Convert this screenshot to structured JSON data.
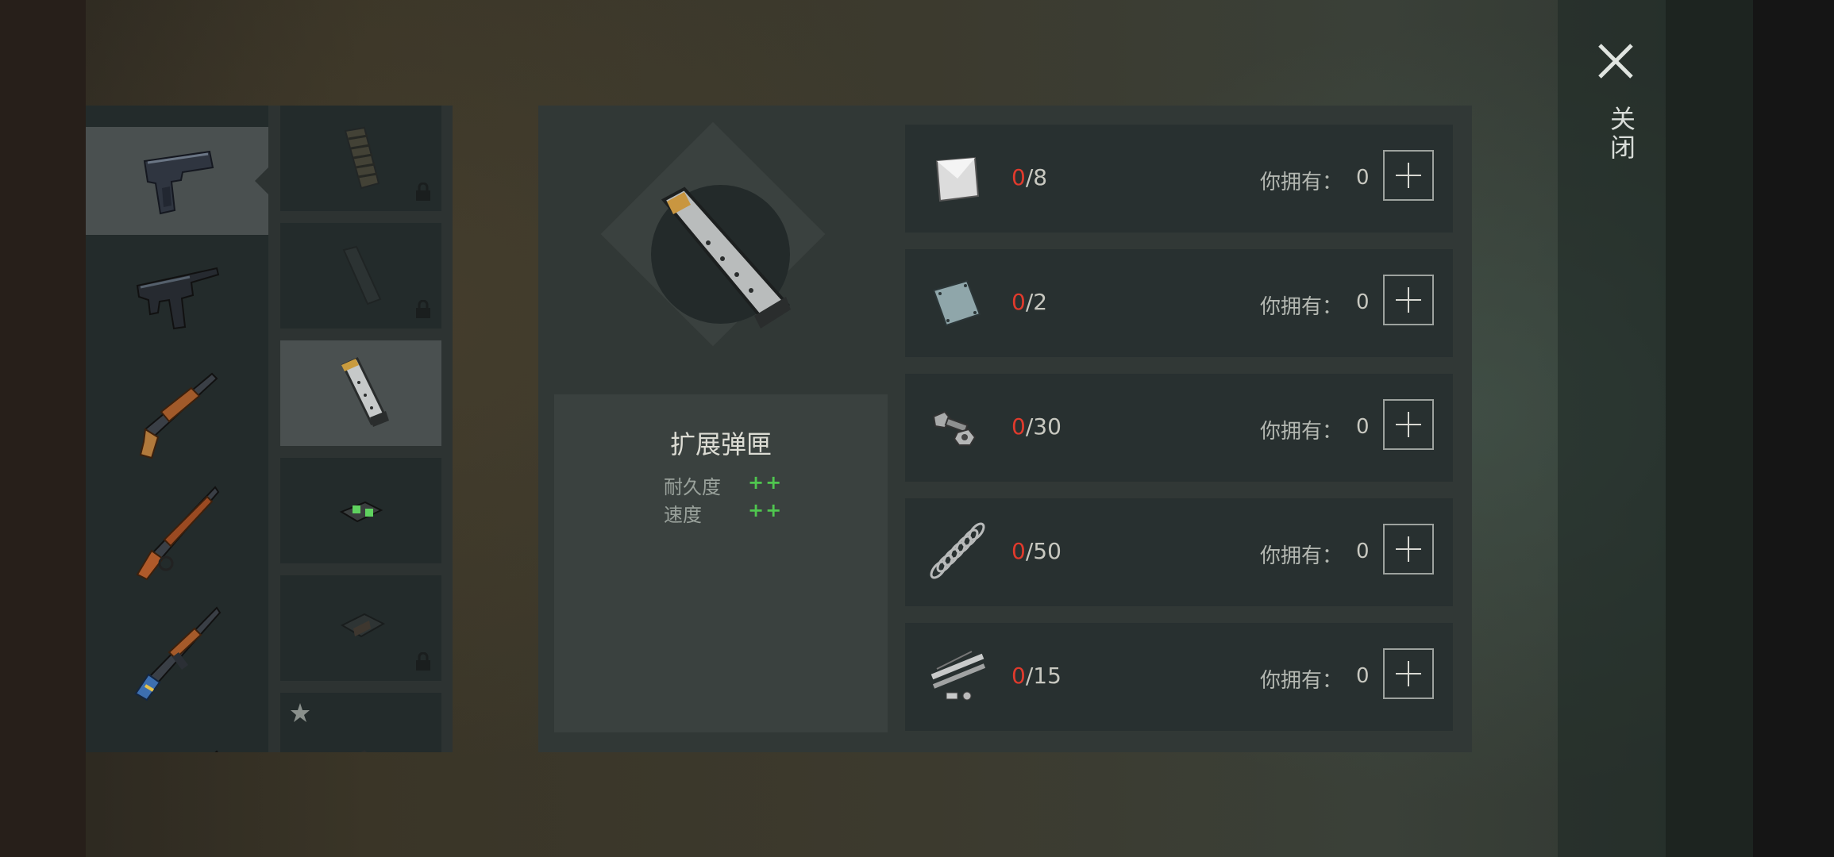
{
  "close": {
    "label": "关闭"
  },
  "item": {
    "name": "扩展弹匣",
    "stats": [
      {
        "label": "耐久度",
        "value": "++"
      },
      {
        "label": "速度",
        "value": "++"
      }
    ]
  },
  "weapons": [
    {
      "icon": "pistol-icon",
      "selected": true
    },
    {
      "icon": "smg-icon"
    },
    {
      "icon": "shotgun-icon"
    },
    {
      "icon": "lever-rifle-icon"
    },
    {
      "icon": "assault-rifle-icon"
    },
    {
      "icon": "rifle-icon"
    }
  ],
  "attachments": [
    {
      "icon": "drum-magazine-icon",
      "locked": true
    },
    {
      "icon": "magazine-icon",
      "locked": true
    },
    {
      "icon": "extended-magazine-icon",
      "selected": true
    },
    {
      "icon": "night-sights-icon"
    },
    {
      "icon": "red-dot-sight-icon",
      "locked": true
    },
    {
      "icon": "rear-sight-icon",
      "starred": true
    }
  ],
  "requirements": [
    {
      "icon": "metal-sheet-icon",
      "have": "0",
      "need": "/8",
      "owned_label": "你拥有：",
      "owned": "0"
    },
    {
      "icon": "steel-plate-icon",
      "have": "0",
      "need": "/2",
      "owned_label": "你拥有：",
      "owned": "0"
    },
    {
      "icon": "bolt-nut-icon",
      "have": "0",
      "need": "/30",
      "owned_label": "你拥有：",
      "owned": "0"
    },
    {
      "icon": "spring-icon",
      "have": "0",
      "need": "/50",
      "owned_label": "你拥有：",
      "owned": "0"
    },
    {
      "icon": "pipes-parts-icon",
      "have": "0",
      "need": "/15",
      "owned_label": "你拥有：",
      "owned": "0"
    }
  ]
}
